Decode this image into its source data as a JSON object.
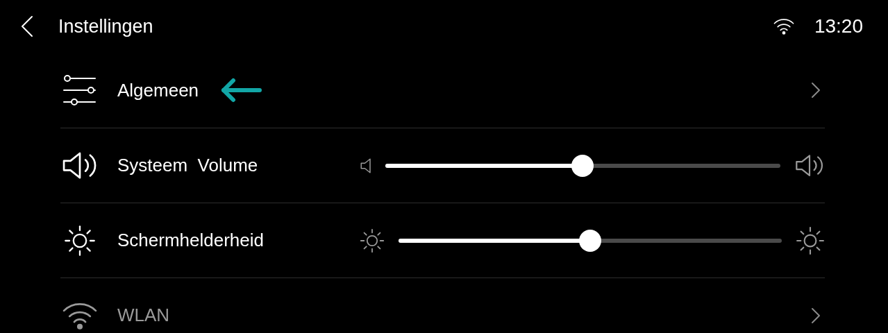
{
  "header": {
    "title": "Instellingen",
    "time": "13:20"
  },
  "rows": [
    {
      "kind": "general",
      "label": "Algemeen",
      "highlighted": true,
      "disabled": false
    },
    {
      "kind": "volume",
      "label": "Systeem  Volume",
      "level": 0.5,
      "disabled": false
    },
    {
      "kind": "brightness",
      "label": "Schermhelderheid",
      "level": 0.5,
      "disabled": false
    },
    {
      "kind": "wlan",
      "label": "WLAN",
      "disabled": true
    }
  ]
}
